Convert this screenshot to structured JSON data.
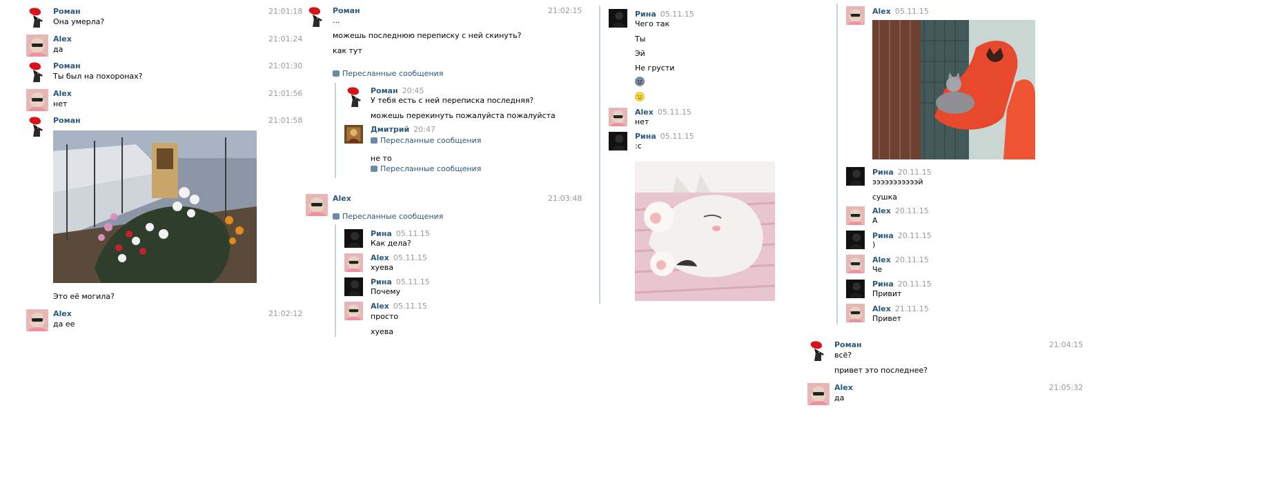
{
  "col1": {
    "m1": {
      "name": "Роман",
      "time": "21:01:18",
      "text": "Она умерла?"
    },
    "m2": {
      "name": "Alex",
      "time": "21:01:24",
      "text": "да"
    },
    "m3": {
      "name": "Роман",
      "time": "21:01:30",
      "text": "Ты был на похоронах?"
    },
    "m4": {
      "name": "Alex",
      "time": "21:01:56",
      "text": "нет"
    },
    "m5": {
      "name": "Роман",
      "time": "21:01:58",
      "caption": "Это её могила?"
    },
    "m6": {
      "name": "Alex",
      "time": "21:02:12",
      "text": "да ее"
    }
  },
  "col2": {
    "m1": {
      "name": "Роман",
      "time": "21:02:15",
      "line1": "...",
      "line2": "можешь последнюю переписку с ней скинуть?",
      "line3": "как тут",
      "fwd": "Пересланные сообщения"
    },
    "f1": {
      "name": "Роман",
      "dt": "20:45",
      "line1": "У тебя есть с ней переписка последняя?",
      "line2": "можешь перекинуть пожалуйста пожалуйста"
    },
    "f2": {
      "name": "Дмитрий",
      "dt": "20:47",
      "fwd": "Пересланные сообщения",
      "text": "не то",
      "fwd2": "Пересланные сообщения"
    },
    "m2": {
      "name": "Alex",
      "time": "21:03:48",
      "fwd": "Пересланные сообщения"
    },
    "g1": {
      "name": "Рина",
      "dt": "05.11.15",
      "text": "Как дела?"
    },
    "g2": {
      "name": "Alex",
      "dt": "05.11.15",
      "text": "хуева"
    },
    "g3": {
      "name": "Рина",
      "dt": "05.11.15",
      "text": "Почему"
    },
    "g4": {
      "name": "Alex",
      "dt": "05.11.15",
      "line1": "просто",
      "line2": "хуева"
    }
  },
  "col3": {
    "r1": {
      "name": "Рина",
      "dt": "05.11.15",
      "line1": "Чего так",
      "line2": "Ты",
      "line3": "Эй",
      "line4": "Не грусти"
    },
    "r2": {
      "name": "Alex",
      "dt": "05.11.15",
      "text": "нет"
    },
    "r3": {
      "name": "Рина",
      "dt": "05.11.15",
      "text": ":c"
    }
  },
  "col4": {
    "a1": {
      "name": "Alex",
      "dt": "05.11.15"
    },
    "a2": {
      "name": "Рина",
      "dt": "20.11.15",
      "line1": "эээээээээээй",
      "line2": "сушка"
    },
    "a3": {
      "name": "Alex",
      "dt": "20.11.15",
      "text": "А"
    },
    "a4": {
      "name": "Рина",
      "dt": "20.11.15",
      "text": ")"
    },
    "a5": {
      "name": "Alex",
      "dt": "20.11.15",
      "text": "Че"
    },
    "a6": {
      "name": "Рина",
      "dt": "20.11.15",
      "text": "Привит"
    },
    "a7": {
      "name": "Alex",
      "dt": "21.11.15",
      "text": "Привет"
    },
    "b1": {
      "name": "Роман",
      "time": "21:04:15",
      "line1": "всё?",
      "line2": "привет это последнее?"
    },
    "b2": {
      "name": "Alex",
      "time": "21:05:32",
      "text": "да"
    }
  }
}
